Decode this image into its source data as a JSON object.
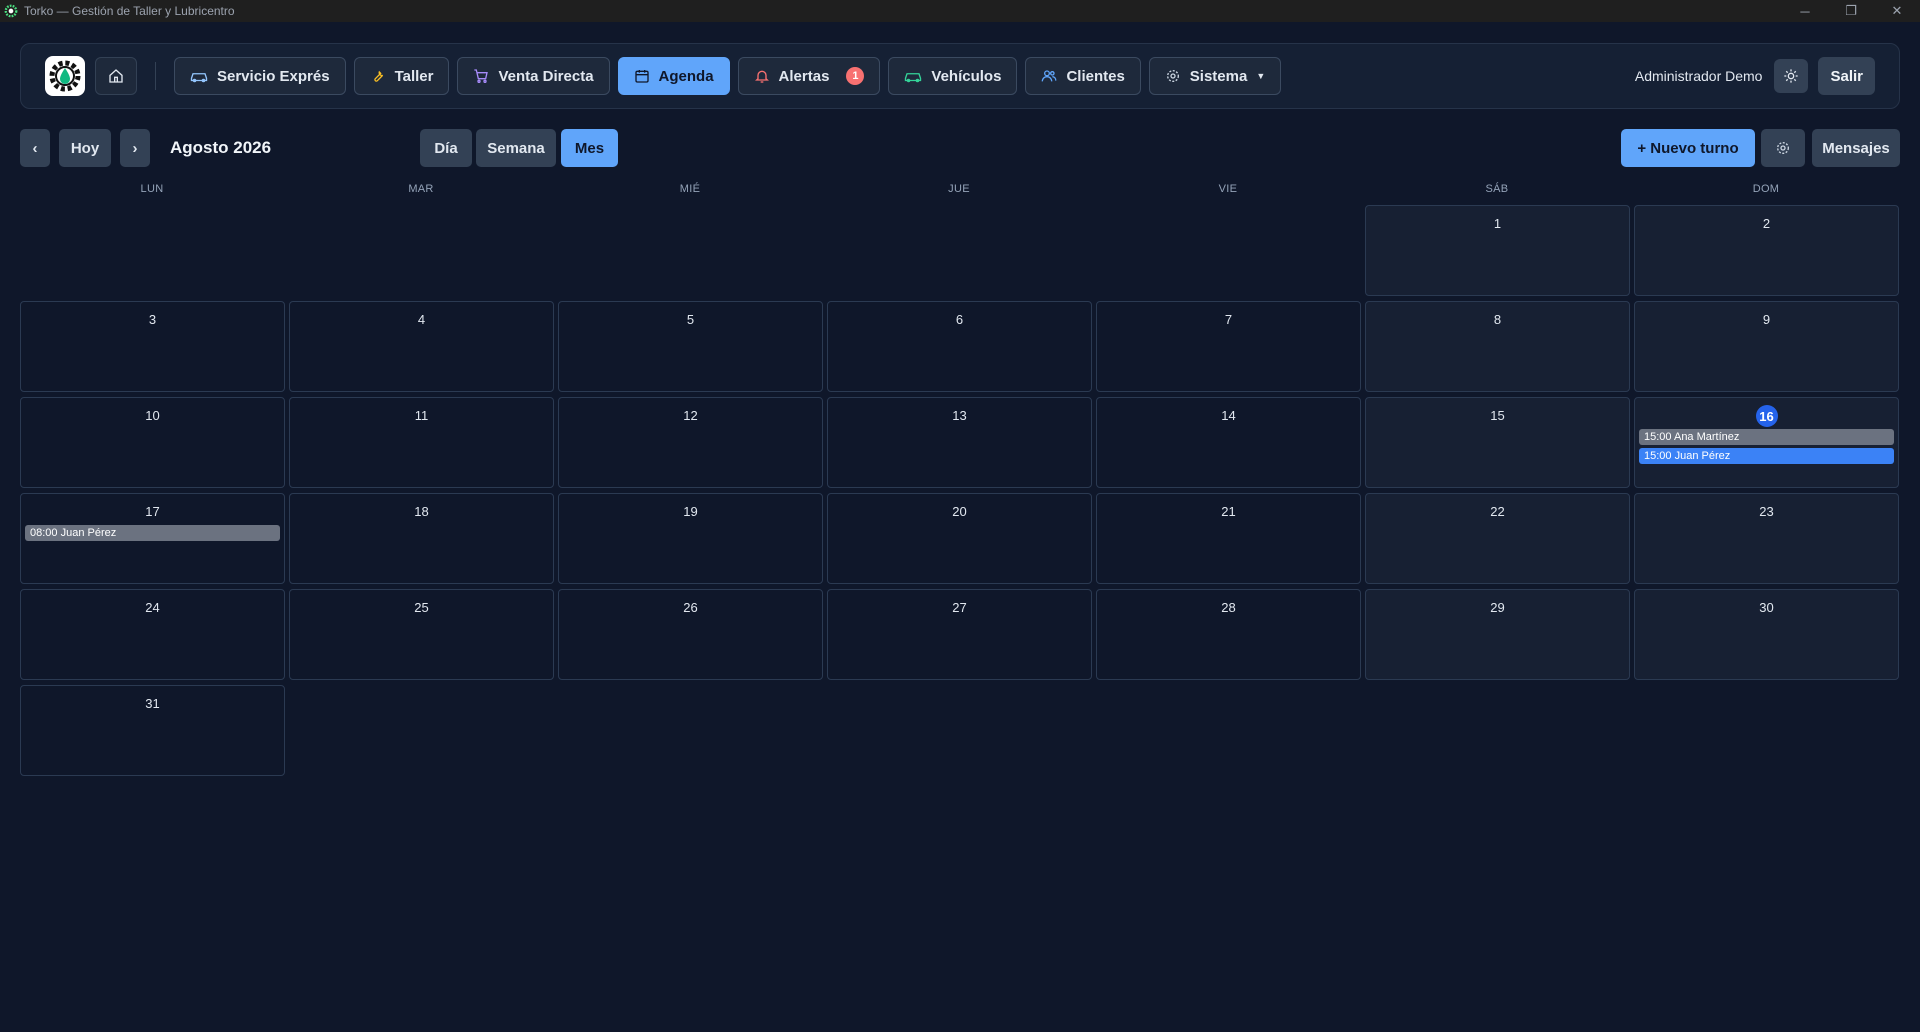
{
  "window": {
    "title": "Torko — Gestión de Taller y Lubricentro",
    "controls": {
      "minimize": "─",
      "restore": "❐",
      "close": "✕"
    }
  },
  "nav": {
    "items": [
      {
        "id": "servicio-expres",
        "label": "Servicio Exprés",
        "icon": "car-icon"
      },
      {
        "id": "taller",
        "label": "Taller",
        "icon": "wrench-icon"
      },
      {
        "id": "venta-directa",
        "label": "Venta Directa",
        "icon": "cart-icon"
      },
      {
        "id": "agenda",
        "label": "Agenda",
        "icon": "calendar-icon",
        "active": true
      },
      {
        "id": "alertas",
        "label": "Alertas",
        "icon": "bell-icon",
        "badge": "1"
      },
      {
        "id": "vehiculos",
        "label": "Vehículos",
        "icon": "car-icon"
      },
      {
        "id": "clientes",
        "label": "Clientes",
        "icon": "users-icon"
      },
      {
        "id": "sistema",
        "label": "Sistema",
        "icon": "gear-icon",
        "dropdown": true
      }
    ],
    "user_name": "Administrador Demo",
    "logout_label": "Salir"
  },
  "toolbar": {
    "prev": "‹",
    "today": "Hoy",
    "next": "›",
    "month_title": "Agosto 2026",
    "views": [
      "Día",
      "Semana",
      "Mes"
    ],
    "active_view": "Mes",
    "new_label": "+ Nuevo turno",
    "messages_label": "Mensajes"
  },
  "calendar": {
    "weekdays": [
      "LUN",
      "MAR",
      "MIÉ",
      "JUE",
      "VIE",
      "SÁB",
      "DOM"
    ],
    "first_weekday_index": 5,
    "days_in_month": 31,
    "today": 16,
    "events": [
      {
        "day": 16,
        "label": "15:00 Ana Martínez",
        "color": "gray"
      },
      {
        "day": 16,
        "label": "15:00 Juan Pérez",
        "color": "blue"
      },
      {
        "day": 17,
        "label": "08:00 Juan Pérez",
        "color": "gray"
      }
    ]
  },
  "colors": {
    "background": "#0f172a",
    "accent": "#60a5fa",
    "today": "#2563eb",
    "badge": "#f87171"
  }
}
